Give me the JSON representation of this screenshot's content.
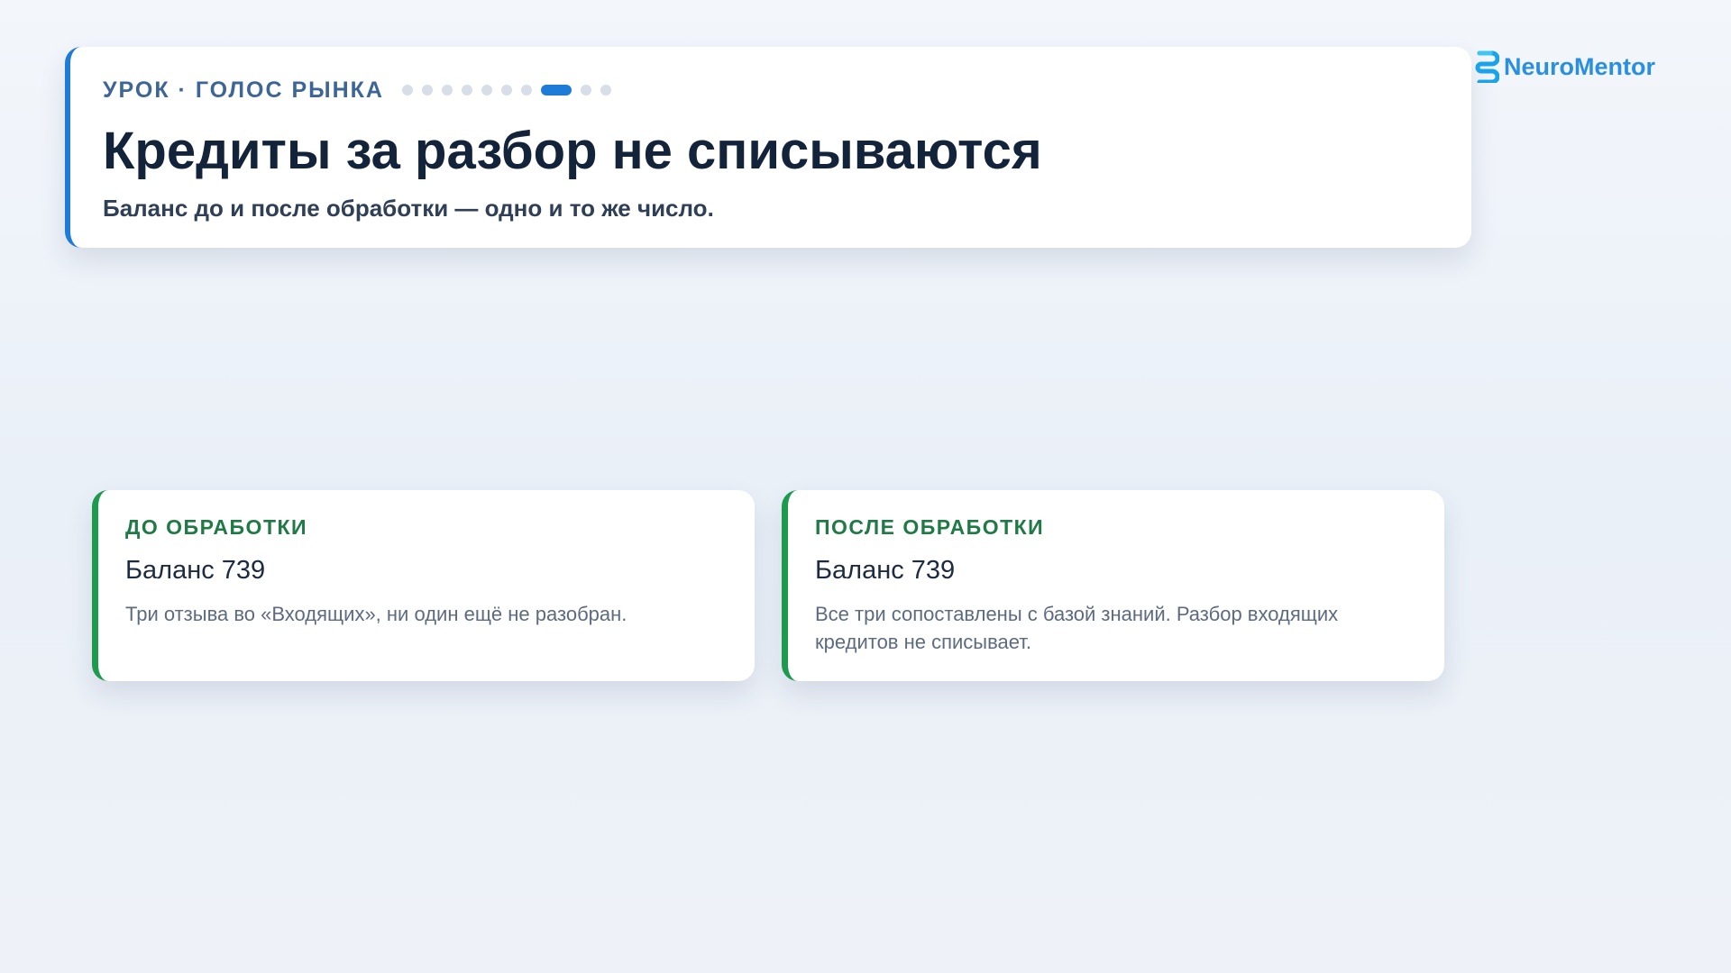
{
  "header": {
    "eyebrow": "УРОК · ГОЛОС РЫНКА",
    "progress": {
      "total_steps": 10,
      "current_step": 8
    },
    "title": "Кредиты за разбор не списываются",
    "subtitle": "Баланс до и после обработки — одно и то же число."
  },
  "brand": {
    "name": "NeuroMentor",
    "icon": "neuromentor-logo-icon",
    "color": "#2b8fe0"
  },
  "cards": {
    "before": {
      "label": "ДО ОБРАБОТКИ",
      "value": "Баланс 739",
      "description": "Три отзыва во «Входящих», ни один ещё не разобран."
    },
    "after": {
      "label": "ПОСЛЕ ОБРАБОТКИ",
      "value": "Баланс 739",
      "description": "Все три сопоставлены с базой знаний. Разбор входящих кредитов не списывает."
    }
  },
  "colors": {
    "accent_blue": "#1f7bd8",
    "accent_green": "#1e9a4f",
    "label_green": "#1f7a45",
    "title": "#13233a"
  }
}
